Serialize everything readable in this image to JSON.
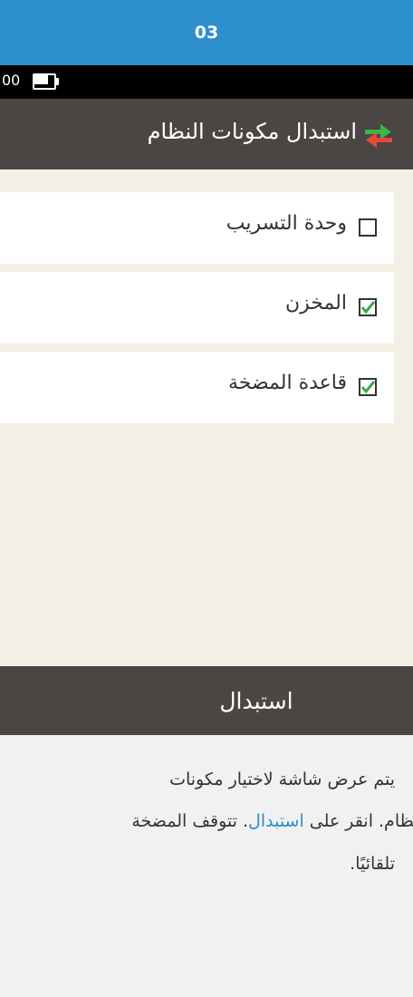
{
  "step": {
    "number": "03"
  },
  "status_bar": {
    "time_fragment": "00",
    "battery_level": 0.7
  },
  "header": {
    "title": "استبدال مكونات النظام",
    "icon": "swap-arrows-icon"
  },
  "options": [
    {
      "label": "وحدة التسريب",
      "checked": false
    },
    {
      "label": "المخزن",
      "checked": true
    },
    {
      "label": "قاعدة المضخة",
      "checked": true
    }
  ],
  "action": {
    "label": "استبدال"
  },
  "instructions": {
    "line1": "يتم عرض شاشة لاختيار مكونات",
    "line2_prefix": "النظام. انقر على ",
    "line2_link": "استبدال",
    "line2_suffix": ". تتوقف المضخة",
    "line3": "تلقائيًا."
  },
  "colors": {
    "step_bar": "#2d8fcb",
    "header": "#4a4644",
    "content_bg": "#f3efe5",
    "check_green": "#3da84a",
    "arrow_green": "#3db54a",
    "arrow_red": "#e8473c",
    "link": "#2d8fcb"
  }
}
